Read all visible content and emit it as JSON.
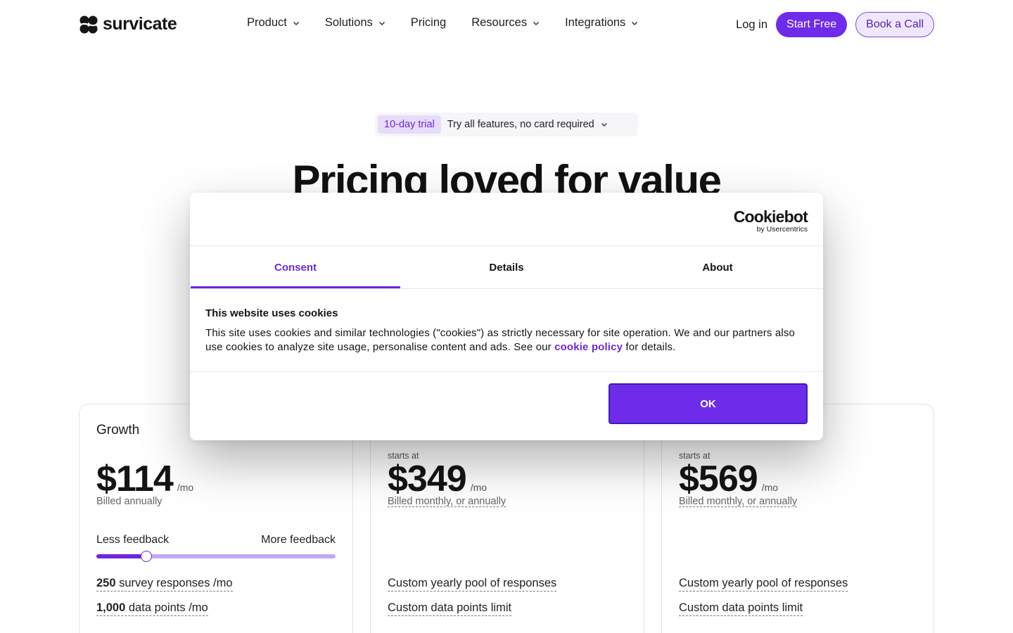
{
  "header": {
    "brand": "survicate",
    "nav": [
      {
        "label": "Product",
        "has_dropdown": true
      },
      {
        "label": "Solutions",
        "has_dropdown": true
      },
      {
        "label": "Pricing",
        "has_dropdown": false
      },
      {
        "label": "Resources",
        "has_dropdown": true
      },
      {
        "label": "Integrations",
        "has_dropdown": true
      }
    ],
    "login_label": "Log in",
    "start_label": "Start Free",
    "book_label": "Book a Call"
  },
  "hero": {
    "trial_tag": "10-day trial",
    "trial_text": "Try all features, no card required",
    "title": "Pricing loved for value"
  },
  "plans": [
    {
      "name": "Growth",
      "starts_at": "",
      "price": "$114",
      "unit": "/mo",
      "billing": "Billed annually",
      "slider_left": "Less feedback",
      "slider_right": "More feedback",
      "slider_level_percent": 21,
      "feature1_bold": "250",
      "feature1_rest": " survey responses /mo",
      "feature2_bold": "1,000",
      "feature2_rest": " data points /mo"
    },
    {
      "name": "",
      "starts_at": "starts at",
      "price": "$349",
      "unit": "/mo",
      "billing": "Billed monthly, or annually",
      "feature1": "Custom yearly pool of responses",
      "feature2": "Custom data points limit"
    },
    {
      "name": "",
      "starts_at": "starts at",
      "price": "$569",
      "unit": "/mo",
      "billing": "Billed monthly, or annually",
      "feature1": "Custom yearly pool of responses",
      "feature2": "Custom data points limit"
    }
  ],
  "cookie": {
    "brand": "Cookiebot",
    "brand_sub": "by Usercentrics",
    "tabs": [
      "Consent",
      "Details",
      "About"
    ],
    "active_tab": "Consent",
    "heading": "This website uses cookies",
    "body_before": "This site uses cookies and similar technologies (\"cookies\") as strictly necessary for site operation. We and our partners also use cookies to analyze site usage, personalise content and ads. See our ",
    "link": "cookie policy",
    "body_after": " for details.",
    "ok_label": "OK"
  },
  "colors": {
    "accent": "#6f2bea",
    "accent_light": "#efe8fd",
    "slider_track": "#c4a8f6"
  }
}
